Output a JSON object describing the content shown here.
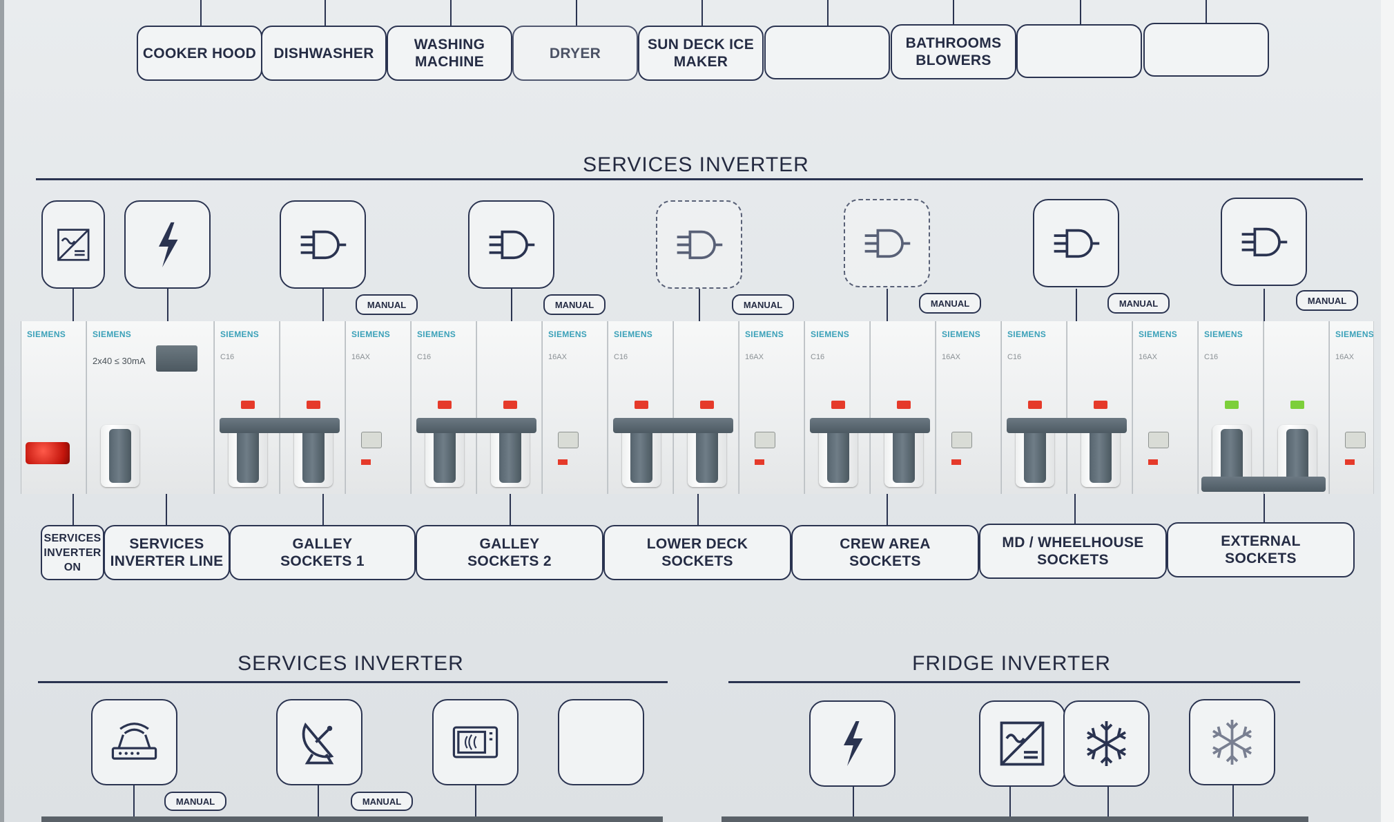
{
  "top_row_labels": [
    "COOKER HOOD",
    "DISHWASHER",
    "WASHING\nMACHINE",
    "DRYER",
    "SUN DECK ICE\nMAKER",
    "",
    "BATHROOMS\nBLOWERS",
    "",
    ""
  ],
  "services_inverter_title": "SERVICES INVERTER",
  "manual_tag": "MANUAL",
  "breaker_brand": "SIEMENS",
  "breaker_rating": "C16",
  "contactor_rating": "16AX",
  "rcd_spec": "2x40 ≤ 30mA",
  "middle_icons": [
    {
      "name": "inverter-icon"
    },
    {
      "name": "lightning-icon"
    },
    {
      "name": "plug-icon"
    },
    {
      "name": "plug-icon"
    },
    {
      "name": "plug-icon"
    },
    {
      "name": "plug-icon"
    },
    {
      "name": "plug-icon"
    },
    {
      "name": "plug-icon"
    }
  ],
  "middle_labels": [
    "SERVICES\nINVERTER\nON",
    "SERVICES\nINVERTER LINE",
    "GALLEY\nSOCKETS 1",
    "GALLEY\nSOCKETS 2",
    "LOWER DECK\nSOCKETS",
    "CREW AREA\nSOCKETS",
    "MD / WHEELHOUSE\nSOCKETS",
    "EXTERNAL\nSOCKETS"
  ],
  "bottom_left_title": "SERVICES INVERTER",
  "bottom_right_title": "FRIDGE INVERTER",
  "bottom_left_icons": [
    "router-icon",
    "satellite-dish-icon",
    "microwave-icon",
    "blank-icon"
  ],
  "bottom_right_icons": [
    "lightning-icon",
    "inverter-icon",
    "snowflake-icon",
    "snowflake-icon"
  ],
  "colors": {
    "ink": "#2a3350",
    "panel": "#e6e9eb",
    "lamp_red": "#e53a2a",
    "lamp_green": "#7ccf3a",
    "brand_teal": "#3aa0b8"
  }
}
